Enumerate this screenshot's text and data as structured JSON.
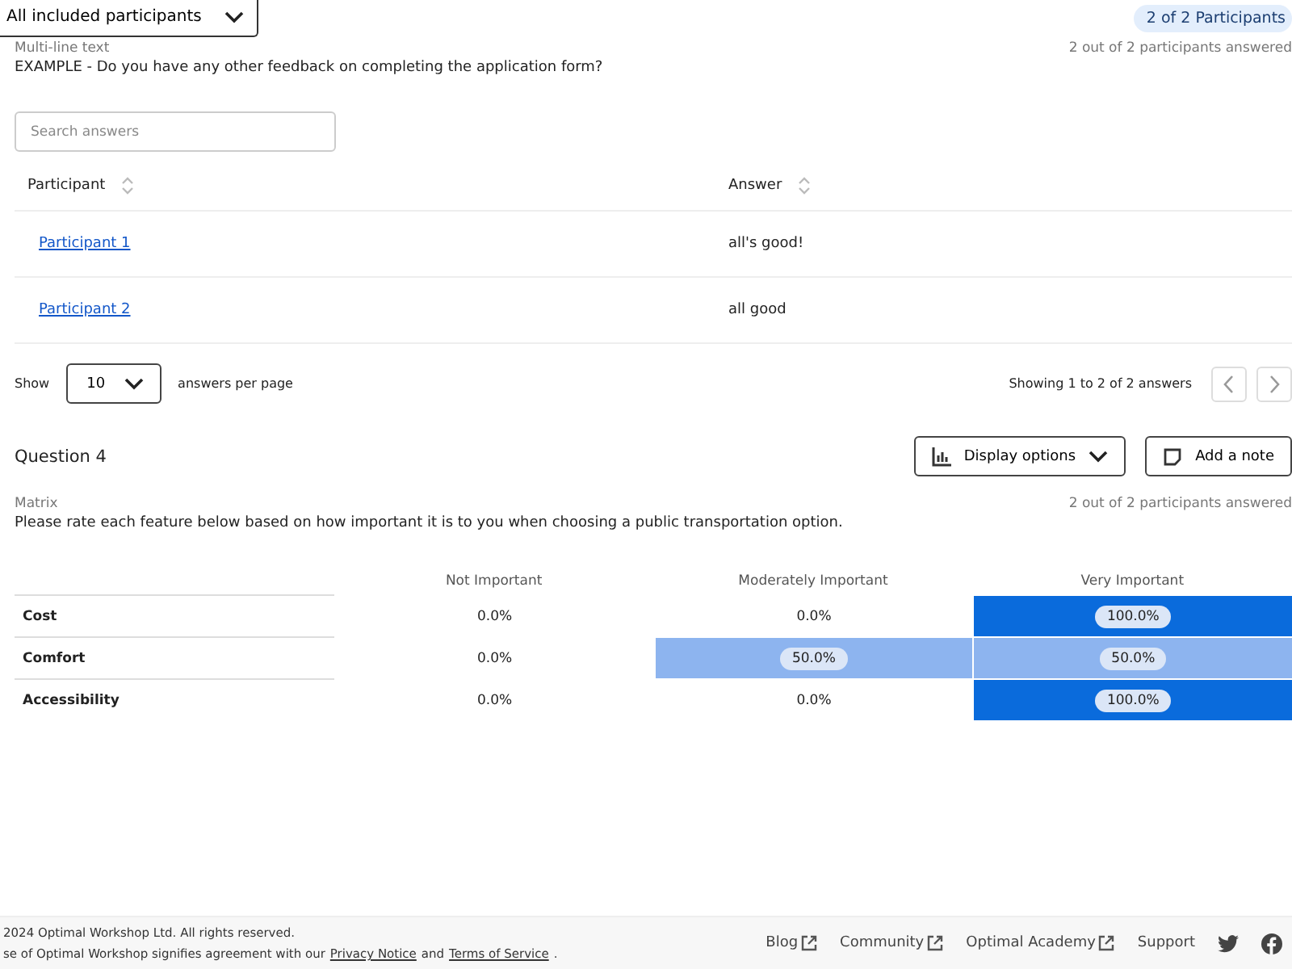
{
  "header": {
    "filter": "All included participants",
    "participants_badge": "2 of 2 Participants"
  },
  "question3": {
    "type": "Multi-line text",
    "answered": "2 out of 2 participants answered",
    "text": "EXAMPLE - Do you have any other feedback on completing the application form?",
    "search": {
      "placeholder": "Search answers"
    },
    "columns": [
      "Participant",
      "Answer"
    ],
    "rows": [
      {
        "participant": "Participant 1",
        "answer": "all's good!"
      },
      {
        "participant": "Participant 2",
        "answer": "all good"
      }
    ],
    "pagination": {
      "show": "Show",
      "per_page": "10",
      "per_page_label": "answers per page",
      "summary": "Showing 1 to 2 of 2 answers"
    }
  },
  "question4": {
    "title": "Question 4",
    "display_options": "Display options",
    "add_note": "Add a note",
    "type": "Matrix",
    "answered": "2 out of 2 participants answered",
    "text": "Please rate each feature below based on how important it is to you when choosing a public transportation option.",
    "columns": [
      "Not Important",
      "Moderately Important",
      "Very Important"
    ],
    "rows": [
      {
        "label": "Cost",
        "cells": [
          {
            "value": "0.0%",
            "color": "#ffffff"
          },
          {
            "value": "0.0%",
            "color": "#ffffff"
          },
          {
            "value": "100.0%",
            "color": "#0a6bdc"
          }
        ]
      },
      {
        "label": "Comfort",
        "cells": [
          {
            "value": "0.0%",
            "color": "#ffffff"
          },
          {
            "value": "50.0%",
            "color": "#8db4ef"
          },
          {
            "value": "50.0%",
            "color": "#8db4ef"
          }
        ]
      },
      {
        "label": "Accessibility",
        "cells": [
          {
            "value": "0.0%",
            "color": "#ffffff"
          },
          {
            "value": "0.0%",
            "color": "#ffffff"
          },
          {
            "value": "100.0%",
            "color": "#0a6bdc"
          }
        ]
      }
    ]
  },
  "footer": {
    "copyright": "2024 Optimal Workshop Ltd. All rights reserved.",
    "notice_start": "se of Optimal Workshop signifies agreement with our",
    "privacy": "Privacy Notice",
    "notice_and": "and",
    "terms": "Terms of Service",
    "notice_end": ".",
    "links": [
      {
        "label": "Blog",
        "external": true
      },
      {
        "label": "Community",
        "external": true
      },
      {
        "label": "Optimal Academy",
        "external": true
      },
      {
        "label": "Support",
        "external": false
      }
    ]
  }
}
